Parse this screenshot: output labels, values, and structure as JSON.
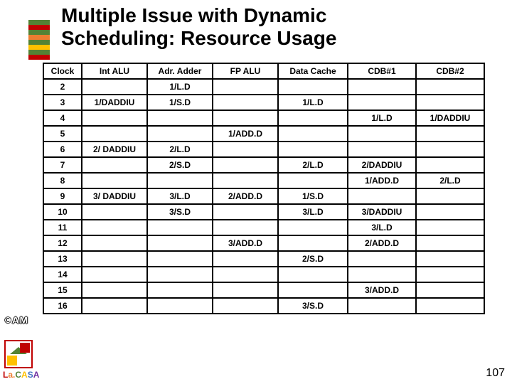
{
  "title": {
    "line1": "Multiple Issue with Dynamic",
    "line2": "Scheduling: Resource Usage"
  },
  "table": {
    "headers": [
      "Clock",
      "Int ALU",
      "Adr. Adder",
      "FP ALU",
      "Data Cache",
      "CDB#1",
      "CDB#2"
    ],
    "rows": [
      {
        "clock": "2",
        "int_alu": "",
        "adr_adder": "1/L.D",
        "fp_alu": "",
        "data_cache": "",
        "cdb1": "",
        "cdb2": ""
      },
      {
        "clock": "3",
        "int_alu": "1/DADDIU",
        "adr_adder": "1/S.D",
        "fp_alu": "",
        "data_cache": "1/L.D",
        "cdb1": "",
        "cdb2": ""
      },
      {
        "clock": "4",
        "int_alu": "",
        "adr_adder": "",
        "fp_alu": "",
        "data_cache": "",
        "cdb1": "1/L.D",
        "cdb2": "1/DADDIU"
      },
      {
        "clock": "5",
        "int_alu": "",
        "adr_adder": "",
        "fp_alu": "1/ADD.D",
        "data_cache": "",
        "cdb1": "",
        "cdb2": ""
      },
      {
        "clock": "6",
        "int_alu": "2/ DADDIU",
        "adr_adder": "2/L.D",
        "fp_alu": "",
        "data_cache": "",
        "cdb1": "",
        "cdb2": ""
      },
      {
        "clock": "7",
        "int_alu": "",
        "adr_adder": "2/S.D",
        "fp_alu": "",
        "data_cache": "2/L.D",
        "cdb1": "2/DADDIU",
        "cdb2": ""
      },
      {
        "clock": "8",
        "int_alu": "",
        "adr_adder": "",
        "fp_alu": "",
        "data_cache": "",
        "cdb1": "1/ADD.D",
        "cdb2": "2/L.D"
      },
      {
        "clock": "9",
        "int_alu": "3/ DADDIU",
        "adr_adder": "3/L.D",
        "fp_alu": "2/ADD.D",
        "data_cache": "1/S.D",
        "cdb1": "",
        "cdb2": ""
      },
      {
        "clock": "10",
        "int_alu": "",
        "adr_adder": "3/S.D",
        "fp_alu": "",
        "data_cache": "3/L.D",
        "cdb1": "3/DADDIU",
        "cdb2": ""
      },
      {
        "clock": "11",
        "int_alu": "",
        "adr_adder": "",
        "fp_alu": "",
        "data_cache": "",
        "cdb1": "3/L.D",
        "cdb2": ""
      },
      {
        "clock": "12",
        "int_alu": "",
        "adr_adder": "",
        "fp_alu": "3/ADD.D",
        "data_cache": "",
        "cdb1": "2/ADD.D",
        "cdb2": ""
      },
      {
        "clock": "13",
        "int_alu": "",
        "adr_adder": "",
        "fp_alu": "",
        "data_cache": "2/S.D",
        "cdb1": "",
        "cdb2": ""
      },
      {
        "clock": "14",
        "int_alu": "",
        "adr_adder": "",
        "fp_alu": "",
        "data_cache": "",
        "cdb1": "",
        "cdb2": ""
      },
      {
        "clock": "15",
        "int_alu": "",
        "adr_adder": "",
        "fp_alu": "",
        "data_cache": "",
        "cdb1": "3/ADD.D",
        "cdb2": ""
      },
      {
        "clock": "16",
        "int_alu": "",
        "adr_adder": "",
        "fp_alu": "",
        "data_cache": "3/S.D",
        "cdb1": "",
        "cdb2": ""
      }
    ]
  },
  "footer": {
    "am_prefix": "©",
    "am_text": "AM",
    "lacasa": {
      "l": "L",
      "a1": "a.",
      "c": "C",
      "a2": "A",
      "s": "S",
      "a3": "A"
    },
    "page_number": "107"
  }
}
